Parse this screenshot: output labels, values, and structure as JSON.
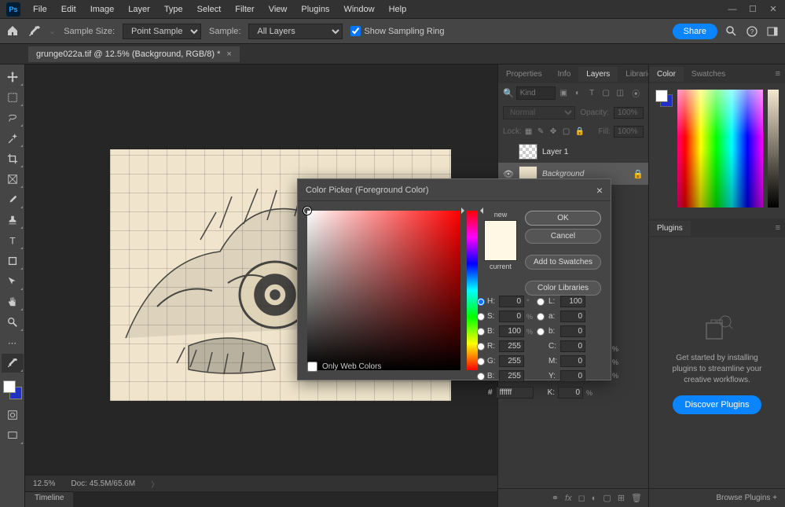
{
  "app": {
    "icon_label": "Ps"
  },
  "menu": [
    "File",
    "Edit",
    "Image",
    "Layer",
    "Type",
    "Select",
    "Filter",
    "View",
    "Plugins",
    "Window",
    "Help"
  ],
  "options": {
    "sample_size_label": "Sample Size:",
    "sample_size_value": "Point Sample",
    "sample_label": "Sample:",
    "sample_value": "All Layers",
    "show_sampling_ring": "Show Sampling Ring",
    "share": "Share"
  },
  "document": {
    "tab_title": "grunge022a.tif @ 12.5% (Background, RGB/8) *",
    "zoom": "12.5%",
    "doc_size": "Doc: 45.5M/65.6M"
  },
  "timeline_label": "Timeline",
  "panels": {
    "properties": "Properties",
    "info": "Info",
    "layers": "Layers",
    "libraries": "Libraries",
    "color": "Color",
    "swatches": "Swatches",
    "plugins": "Plugins"
  },
  "layers": {
    "filter_placeholder": "Kind",
    "blend_mode": "Normal",
    "opacity_label": "Opacity:",
    "opacity_value": "100%",
    "lock_label": "Lock:",
    "fill_label": "Fill:",
    "fill_value": "100%",
    "items": [
      {
        "name": "Layer 1",
        "visible": false,
        "locked": false
      },
      {
        "name": "Background",
        "visible": true,
        "locked": true
      }
    ]
  },
  "plugins_panel": {
    "text": "Get started by installing plugins to streamline your creative workflows.",
    "discover": "Discover Plugins",
    "browse": "Browse Plugins  +"
  },
  "color_picker": {
    "title": "Color Picker (Foreground Color)",
    "ok": "OK",
    "cancel": "Cancel",
    "add_swatches": "Add to Swatches",
    "color_libraries": "Color Libraries",
    "new_label": "new",
    "current_label": "current",
    "only_web": "Only Web Colors",
    "fields": {
      "H": "0",
      "H_unit": "°",
      "S": "0",
      "B": "100",
      "R": "255",
      "G": "255",
      "Bv": "255",
      "L": "100",
      "a": "0",
      "b": "0",
      "C": "0",
      "M": "0",
      "Y": "0",
      "K": "0",
      "hex": "ffffff"
    }
  },
  "colors": {
    "accent": "#0a84ff",
    "foreground": "#ffffff",
    "background": "#2030c0",
    "picker_new": "#fff8e5",
    "picker_current": "#fff8e5"
  }
}
